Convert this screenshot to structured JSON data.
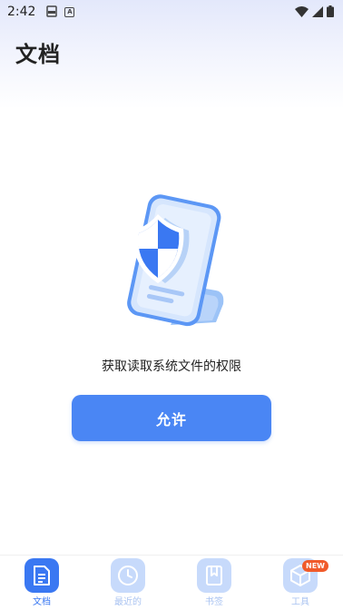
{
  "status_bar": {
    "time": "2:42",
    "left_icons": [
      "pdf-icon",
      "font-a-icon"
    ],
    "right_icons": [
      "wifi-icon",
      "signal-icon",
      "battery-icon"
    ]
  },
  "header": {
    "title": "文档"
  },
  "permission": {
    "message": "获取读取系统文件的权限",
    "allow_label": "允许"
  },
  "bottom_nav": {
    "items": [
      {
        "label": "文档",
        "icon": "document-icon",
        "active": true
      },
      {
        "label": "最近的",
        "icon": "clock-icon",
        "active": false
      },
      {
        "label": "书签",
        "icon": "bookmark-icon",
        "active": false
      },
      {
        "label": "工具",
        "icon": "tools-box-icon",
        "active": false,
        "badge": "NEW"
      }
    ]
  },
  "colors": {
    "accent": "#4a86f4",
    "nav_active": "#3a78f2",
    "nav_inactive_bg": "#c7dafb",
    "badge": "#f05a2a"
  }
}
